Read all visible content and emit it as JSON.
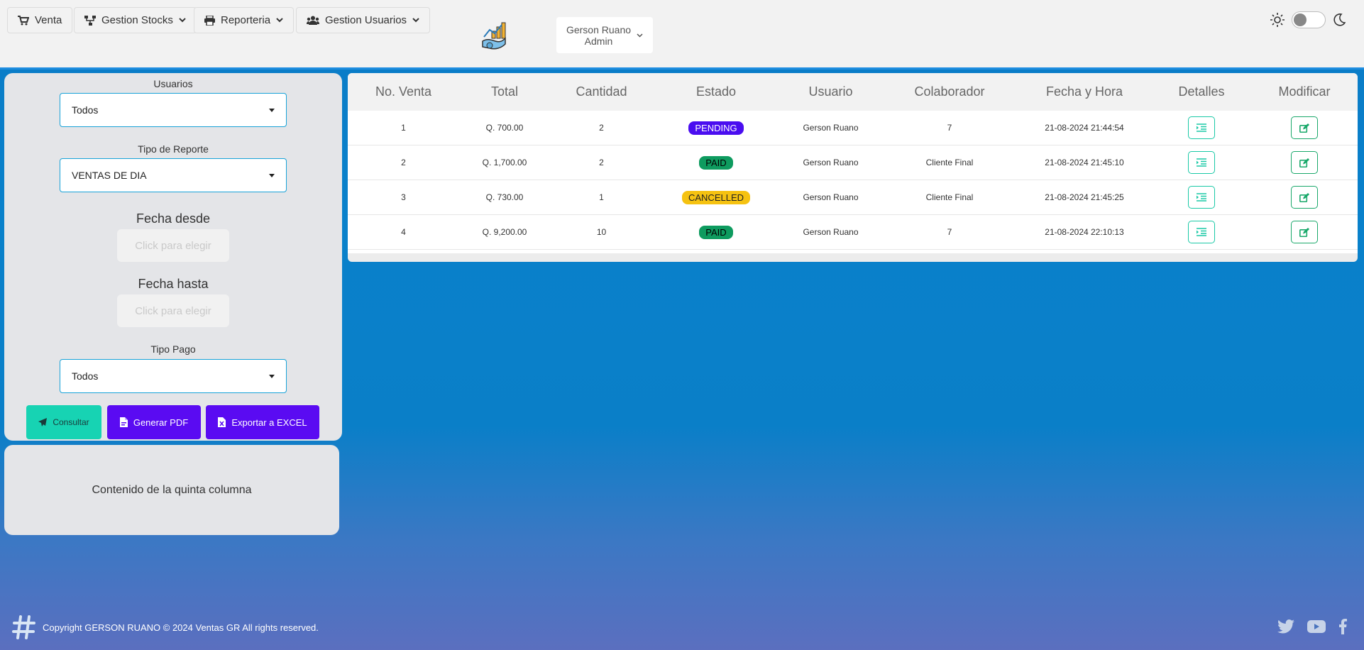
{
  "navbar": {
    "items": [
      {
        "label": "Venta",
        "icon": "cart-icon"
      },
      {
        "label": "Gestion Stocks",
        "icon": "sitemap-icon"
      },
      {
        "label": "Reporteria",
        "icon": "printer-icon"
      },
      {
        "label": "Gestion Usuarios",
        "icon": "users-icon"
      }
    ],
    "user": {
      "name": "Gerson Ruano",
      "role": "Admin"
    }
  },
  "filters": {
    "usuarios_label": "Usuarios",
    "usuarios_value": "Todos",
    "tipo_reporte_label": "Tipo de Reporte",
    "tipo_reporte_value": "VENTAS DE DIA",
    "fecha_desde_label": "Fecha desde",
    "fecha_desde_placeholder": "Click para elegir",
    "fecha_hasta_label": "Fecha hasta",
    "fecha_hasta_placeholder": "Click para elegir",
    "tipo_pago_label": "Tipo Pago",
    "tipo_pago_value": "Todos",
    "consultar_label": "Consultar",
    "pdf_label": "Generar PDF",
    "excel_label": "Exportar a EXCEL"
  },
  "fifth_column": "Contenido de la quinta columna",
  "table": {
    "headers": [
      "No. Venta",
      "Total",
      "Cantidad",
      "Estado",
      "Usuario",
      "Colaborador",
      "Fecha y Hora",
      "Detalles",
      "Modificar"
    ],
    "rows": [
      {
        "no": "1",
        "total": "Q. 700.00",
        "cantidad": "2",
        "estado": "PENDING",
        "usuario": "Gerson Ruano",
        "colaborador": "7",
        "fecha": "21-08-2024 21:44:54"
      },
      {
        "no": "2",
        "total": "Q. 1,700.00",
        "cantidad": "2",
        "estado": "PAID",
        "usuario": "Gerson Ruano",
        "colaborador": "Cliente Final",
        "fecha": "21-08-2024 21:45:10"
      },
      {
        "no": "3",
        "total": "Q. 730.00",
        "cantidad": "1",
        "estado": "CANCELLED",
        "usuario": "Gerson Ruano",
        "colaborador": "Cliente Final",
        "fecha": "21-08-2024 21:45:25"
      },
      {
        "no": "4",
        "total": "Q. 9,200.00",
        "cantidad": "10",
        "estado": "PAID",
        "usuario": "Gerson Ruano",
        "colaborador": "7",
        "fecha": "21-08-2024 22:10:13"
      }
    ]
  },
  "status_colors": {
    "PENDING": "#4a0df0",
    "PAID": "#0e9b5f",
    "CANCELLED": "#f5c211"
  },
  "footer": {
    "copyright": "Copyright GERSON RUANO © 2024 Ventas GR All rights reserved."
  }
}
